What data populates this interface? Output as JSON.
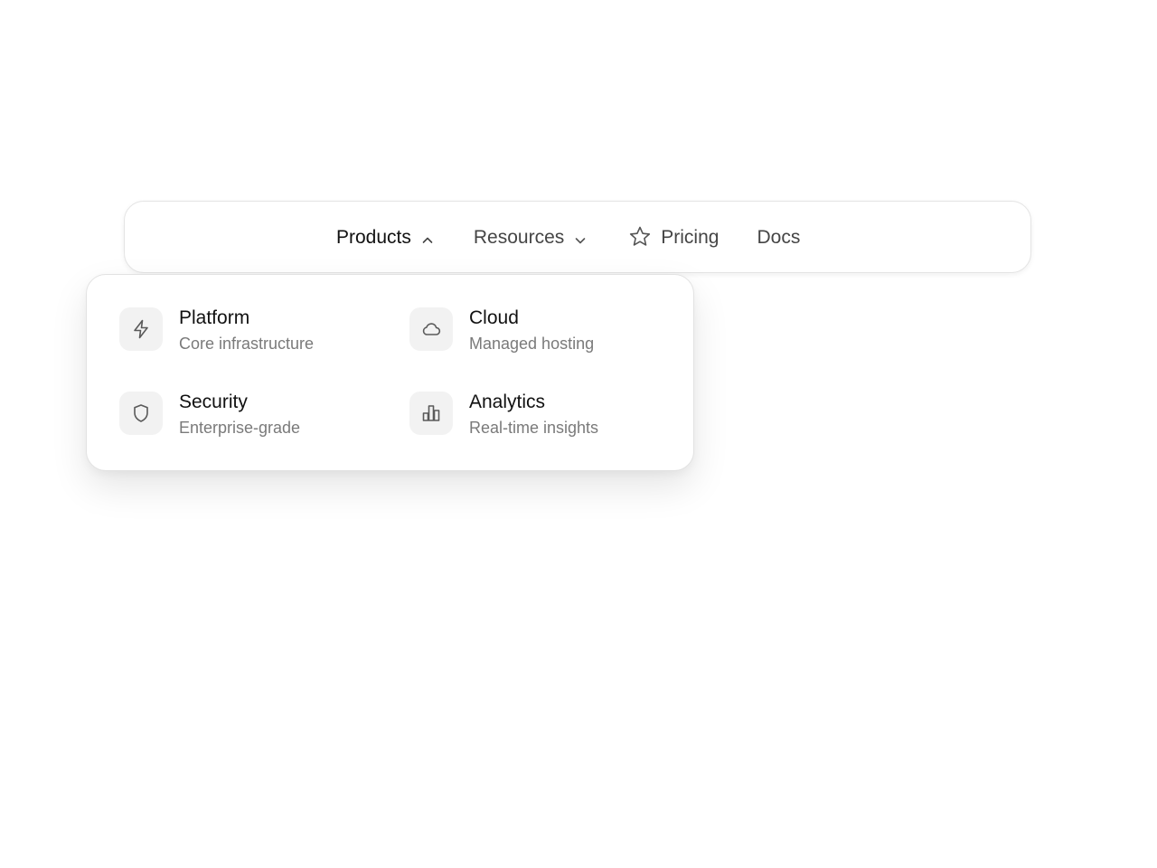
{
  "nav": {
    "items": [
      {
        "label": "Products",
        "icon": "chevron-up-icon",
        "active": true
      },
      {
        "label": "Resources",
        "icon": "chevron-down-icon",
        "active": false
      },
      {
        "label": "Pricing",
        "icon": "star-icon",
        "active": false
      },
      {
        "label": "Docs",
        "active": false
      }
    ]
  },
  "dropdown": {
    "items": [
      {
        "title": "Platform",
        "description": "Core infrastructure",
        "icon": "lightning-icon"
      },
      {
        "title": "Cloud",
        "description": "Managed hosting",
        "icon": "cloud-icon"
      },
      {
        "title": "Security",
        "description": "Enterprise-grade",
        "icon": "shield-icon"
      },
      {
        "title": "Analytics",
        "description": "Real-time insights",
        "icon": "bar-chart-icon"
      }
    ]
  },
  "colors": {
    "text_primary": "#111111",
    "text_secondary": "#7a7a7a",
    "nav_text": "#454545",
    "icon_box_bg": "#f2f2f2",
    "border": "#e4e4e4"
  }
}
